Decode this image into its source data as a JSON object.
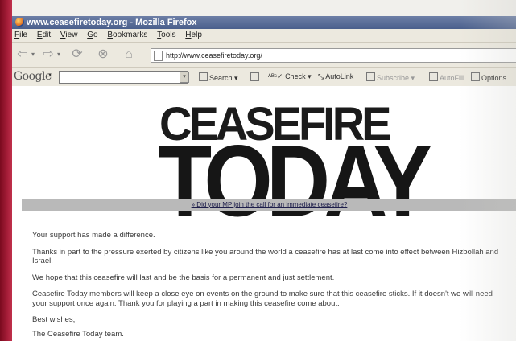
{
  "window": {
    "title": "www.ceasefiretoday.org - Mozilla Firefox"
  },
  "menu": [
    "File",
    "Edit",
    "View",
    "Go",
    "Bookmarks",
    "Tools",
    "Help"
  ],
  "nav": {
    "url": "http://www.ceasefiretoday.org/"
  },
  "google_toolbar": {
    "logo": "Google",
    "search_value": "",
    "search_label": "Search",
    "check_label": "Check",
    "autolink_label": "AutoLink",
    "subscribe_label": "Subscribe",
    "autofill_label": "AutoFill",
    "options_label": "Options"
  },
  "page": {
    "logo_line1": "CEASEFIRE",
    "logo_line2": "TODAY",
    "banner_link": "» Did your MP join the call for an immediate ceasefire?",
    "paragraphs": [
      "Your support has made a difference.",
      "Thanks in part to the pressure exerted by citizens like you around the world a ceasefire has at last come into effect between Hizbollah and Israel.",
      "We hope that this ceasefire will last and be the basis for a permanent and just settlement.",
      "Ceasefire Today members will keep a close eye on events on the ground to make sure that this ceasefire sticks. If it doesn't we will need your support once again. Thank you for playing a part in making this ceasefire come about.",
      "Best wishes,",
      "The Ceasefire Today team."
    ]
  }
}
